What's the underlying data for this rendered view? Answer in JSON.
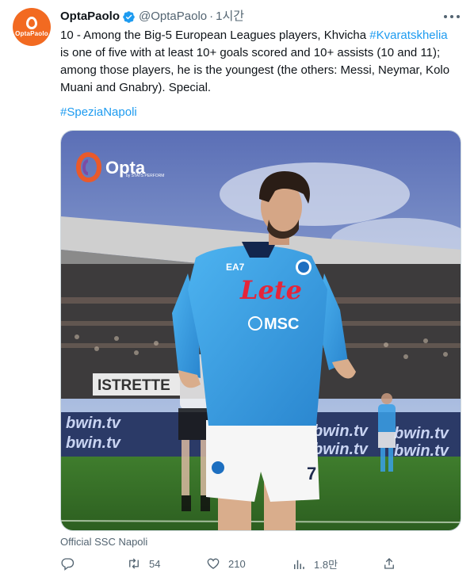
{
  "author": {
    "display_name": "OptaPaolo",
    "handle": "@OptaPaolo",
    "separator": "·",
    "time": "1시간",
    "avatar_text": "OptaPaolo",
    "verified": true
  },
  "tweet": {
    "text_part1": "10 - Among the Big-5 European Leagues players, Khvicha ",
    "text_hashtag1": "#Kvaratskhelia",
    "text_part2": "\nis one of five with at least 10+ goals scored and 10+ assists (10 and 11);\namong those players, he is the youngest (the others: Messi, Neymar, Kolo\nMuani and Gnabry). Special.",
    "hashtag2": "#SpeziaNapoli"
  },
  "media": {
    "logo_text": "Opta",
    "logo_subtext": "by STATS PERFORM",
    "shirt_sponsor": "Lete",
    "shirt_sponsor2": "MSC",
    "shirt_brand": "EA7",
    "board_text": "bwin.tv",
    "stand_text": "ISTRETTE",
    "shorts_number": "7"
  },
  "caption": "Official SSC Napoli",
  "actions": {
    "replies": "",
    "retweets": "54",
    "likes": "210",
    "views": "1.8만"
  },
  "colors": {
    "accent": "#1d9bf0",
    "muted": "#536471",
    "avatar_bg": "#f26a21",
    "jersey": "#3aa0e6"
  }
}
